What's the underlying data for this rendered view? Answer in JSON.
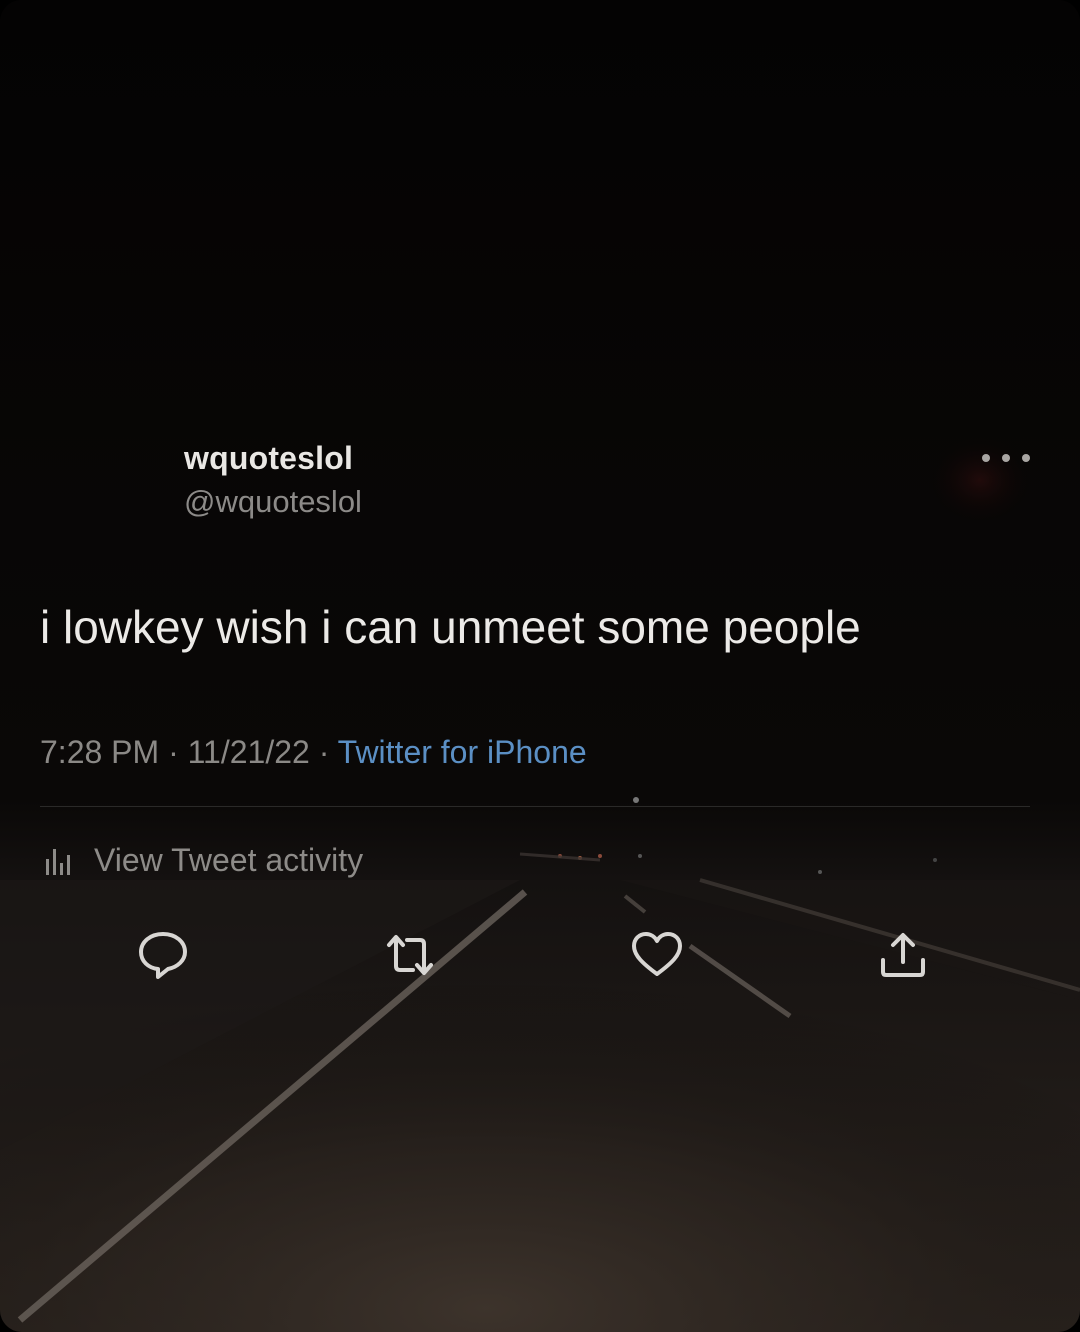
{
  "tweet": {
    "display_name": "wquoteslol",
    "handle": "@wquoteslol",
    "text": "i lowkey wish i can unmeet some people",
    "time": "7:28 PM",
    "separator": " · ",
    "date": "11/21/22",
    "source": "Twitter for iPhone",
    "source_color": "#5b8fc4"
  },
  "activity": {
    "label": "View Tweet activity",
    "icon": "bar-chart-icon"
  },
  "actions": [
    {
      "name": "reply",
      "icon": "speech-bubble-icon"
    },
    {
      "name": "retweet",
      "icon": "retweet-arrows-icon"
    },
    {
      "name": "like",
      "icon": "heart-icon"
    },
    {
      "name": "share",
      "icon": "share-upload-icon"
    }
  ],
  "more_menu": {
    "icon": "ellipsis-icon"
  },
  "background": {
    "icon": "night-highway-photo"
  }
}
